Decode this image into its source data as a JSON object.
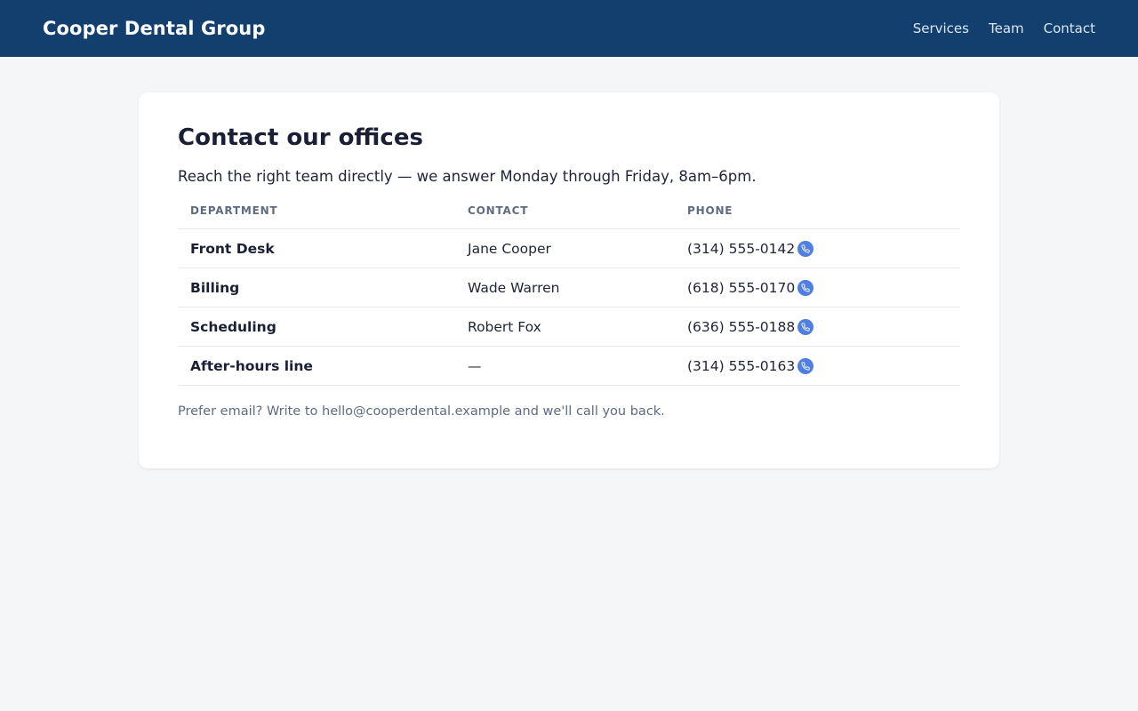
{
  "header": {
    "brand": "Cooper Dental Group",
    "nav": [
      "Services",
      "Team",
      "Contact"
    ]
  },
  "main": {
    "title": "Contact our offices",
    "subtitle": "Reach the right team directly — we answer Monday through Friday, 8am–6pm.",
    "table": {
      "columns": [
        "DEPARTMENT",
        "CONTACT",
        "PHONE"
      ],
      "rows": [
        {
          "department": "Front Desk",
          "contact": "Jane Cooper",
          "phone": "(314) 555-0142"
        },
        {
          "department": "Billing",
          "contact": "Wade Warren",
          "phone": "(618) 555-0170"
        },
        {
          "department": "Scheduling",
          "contact": "Robert Fox",
          "phone": "(636) 555-0188"
        },
        {
          "department": "After-hours line",
          "contact": "—",
          "phone": "(314) 555-0163"
        }
      ]
    },
    "note": "Prefer email? Write to hello@cooperdental.example and we'll call you back."
  },
  "icons": {
    "call": "phone-icon"
  },
  "colors": {
    "header_bg": "#123f6e",
    "accent": "#4f7fe0",
    "page_bg": "#f5f6f8"
  }
}
